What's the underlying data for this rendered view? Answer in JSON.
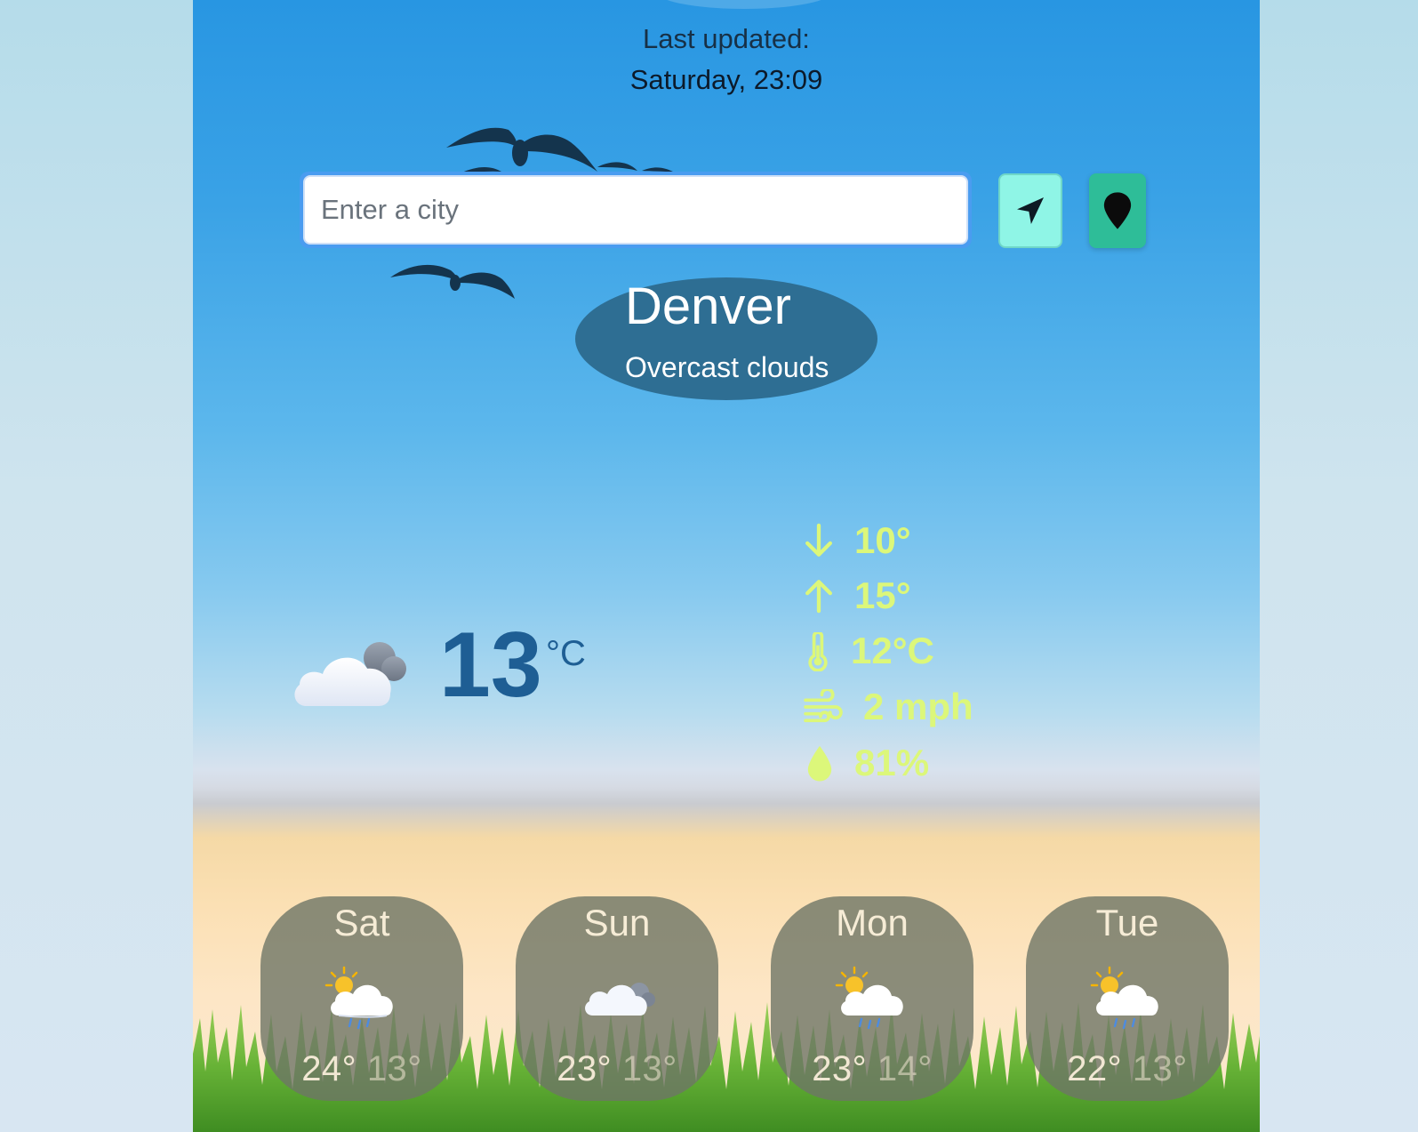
{
  "header": {
    "updated_label": "Last updated:",
    "updated_value": "Saturday, 23:09"
  },
  "search": {
    "placeholder": "Enter a city",
    "value": "",
    "current_location_icon": "navigation-arrow-icon",
    "map_pin_icon": "map-pin-icon"
  },
  "city": {
    "name": "Denver",
    "description": "Overcast clouds"
  },
  "current": {
    "icon": "overcast-cloud-icon",
    "temperature": "13",
    "unit": "°C"
  },
  "stats": {
    "min": "10°",
    "max": "15°",
    "feels_like": "12°C",
    "wind": "2 mph",
    "humidity": "81%"
  },
  "forecast": [
    {
      "day": "Sat",
      "icon": "sun-cloud-rain-icon",
      "high": "24°",
      "low": "13°"
    },
    {
      "day": "Sun",
      "icon": "overcast-cloud-icon",
      "high": "23°",
      "low": "13°"
    },
    {
      "day": "Mon",
      "icon": "sun-cloud-rain-icon",
      "high": "23°",
      "low": "14°"
    },
    {
      "day": "Tue",
      "icon": "sun-cloud-rain-icon",
      "high": "22°",
      "low": "13°"
    }
  ],
  "colors": {
    "accent_stats": "#dcf77a",
    "city_pill": "#2e6e93",
    "nav_button": "#8ff5e6",
    "pin_button": "#2ebd98",
    "temperature": "#1e5e94"
  }
}
